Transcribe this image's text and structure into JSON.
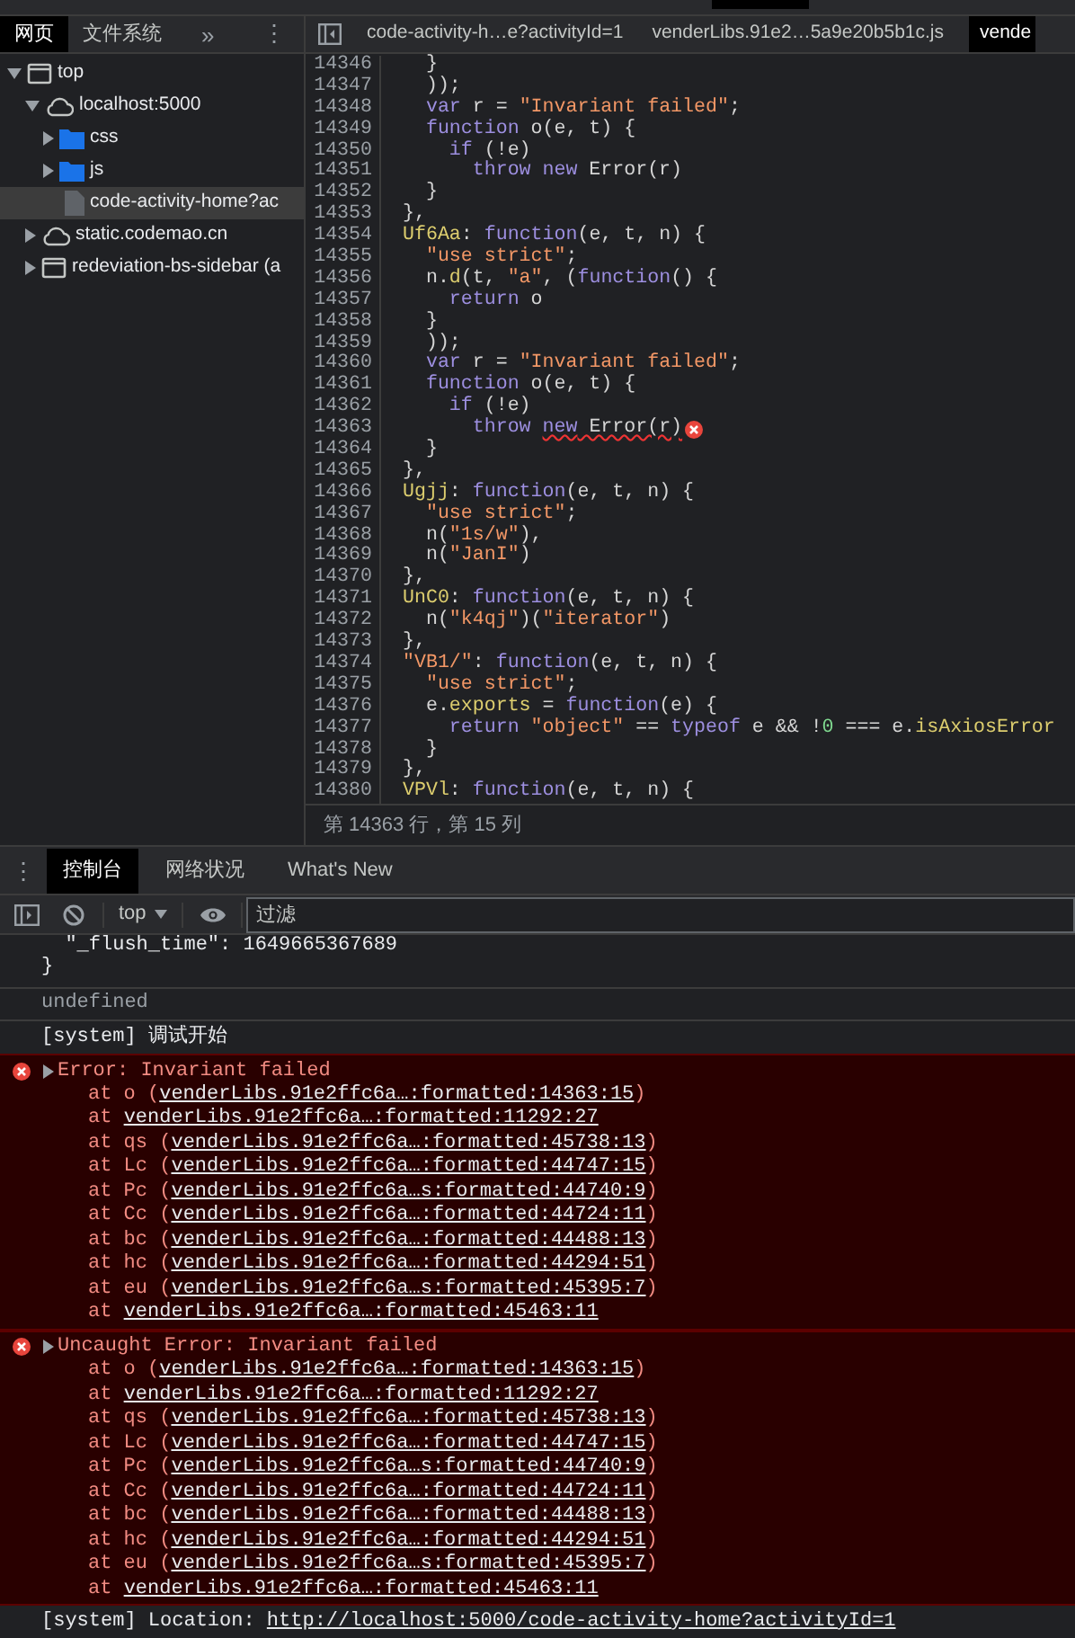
{
  "navigator": {
    "tabs": [
      {
        "label": "网页",
        "selected": true
      },
      {
        "label": "文件系统",
        "selected": false
      }
    ],
    "more": "»",
    "menu": "⋮"
  },
  "tree": [
    {
      "label": "top",
      "kind": "frame",
      "expanded": true,
      "selected": false,
      "children": [
        {
          "label": "localhost:5000",
          "kind": "cloud",
          "expanded": true,
          "selected": false,
          "children": [
            {
              "label": "css",
              "kind": "folder",
              "expanded": false,
              "selected": false
            },
            {
              "label": "js",
              "kind": "folder",
              "expanded": false,
              "selected": false
            },
            {
              "label": "code-activity-home?ac",
              "kind": "file",
              "selected": true
            }
          ]
        },
        {
          "label": "static.codemao.cn",
          "kind": "cloud",
          "expanded": false,
          "selected": false
        },
        {
          "label": "redeviation-bs-sidebar (a",
          "kind": "frame",
          "expanded": false,
          "selected": false
        }
      ]
    }
  ],
  "editor": {
    "tabs": [
      {
        "label": "code-activity-h…e?activityId=1",
        "selected": false
      },
      {
        "label": "venderLibs.91e2…5a9e20b5b1c.js",
        "selected": false
      },
      {
        "label": "vende",
        "selected": true
      }
    ],
    "lines": [
      {
        "number": "14346",
        "error": false,
        "tokens": [
          {
            "kind": "plain",
            "text": "  }"
          }
        ]
      },
      {
        "number": "14347",
        "error": false,
        "tokens": [
          {
            "kind": "plain",
            "text": "  ));"
          }
        ]
      },
      {
        "number": "14348",
        "error": false,
        "tokens": [
          {
            "kind": "keyword",
            "text": "  var"
          },
          {
            "kind": "plain",
            "text": " r = "
          },
          {
            "kind": "string",
            "text": "\"Invariant failed\""
          },
          {
            "kind": "plain",
            "text": ";"
          }
        ]
      },
      {
        "number": "14349",
        "error": false,
        "tokens": [
          {
            "kind": "keyword",
            "text": "  function"
          },
          {
            "kind": "plain",
            "text": " o(e, t) {"
          }
        ]
      },
      {
        "number": "14350",
        "error": false,
        "tokens": [
          {
            "kind": "keyword",
            "text": "    if"
          },
          {
            "kind": "plain",
            "text": " (!e)"
          }
        ]
      },
      {
        "number": "14351",
        "error": false,
        "tokens": [
          {
            "kind": "keyword",
            "text": "      throw new"
          },
          {
            "kind": "plain",
            "text": " Error(r)"
          }
        ]
      },
      {
        "number": "14352",
        "error": false,
        "tokens": [
          {
            "kind": "plain",
            "text": "  }"
          }
        ]
      },
      {
        "number": "14353",
        "error": false,
        "tokens": [
          {
            "kind": "plain",
            "text": "},"
          }
        ]
      },
      {
        "number": "14354",
        "error": false,
        "tokens": [
          {
            "kind": "name",
            "text": "Uf6Aa"
          },
          {
            "kind": "plain",
            "text": ": "
          },
          {
            "kind": "keyword",
            "text": "function"
          },
          {
            "kind": "plain",
            "text": "(e, t, n) {"
          }
        ]
      },
      {
        "number": "14355",
        "error": false,
        "tokens": [
          {
            "kind": "string",
            "text": "  \"use strict\""
          },
          {
            "kind": "plain",
            "text": ";"
          }
        ]
      },
      {
        "number": "14356",
        "error": false,
        "tokens": [
          {
            "kind": "plain",
            "text": "  n."
          },
          {
            "kind": "name",
            "text": "d"
          },
          {
            "kind": "plain",
            "text": "(t, "
          },
          {
            "kind": "string",
            "text": "\"a\""
          },
          {
            "kind": "plain",
            "text": ", ("
          },
          {
            "kind": "keyword",
            "text": "function"
          },
          {
            "kind": "plain",
            "text": "() {"
          }
        ]
      },
      {
        "number": "14357",
        "error": false,
        "tokens": [
          {
            "kind": "keyword",
            "text": "    return"
          },
          {
            "kind": "plain",
            "text": " o"
          }
        ]
      },
      {
        "number": "14358",
        "error": false,
        "tokens": [
          {
            "kind": "plain",
            "text": "  }"
          }
        ]
      },
      {
        "number": "14359",
        "error": false,
        "tokens": [
          {
            "kind": "plain",
            "text": "  ));"
          }
        ]
      },
      {
        "number": "14360",
        "error": false,
        "tokens": [
          {
            "kind": "keyword",
            "text": "  var"
          },
          {
            "kind": "plain",
            "text": " r = "
          },
          {
            "kind": "string",
            "text": "\"Invariant failed\""
          },
          {
            "kind": "plain",
            "text": ";"
          }
        ]
      },
      {
        "number": "14361",
        "error": false,
        "tokens": [
          {
            "kind": "keyword",
            "text": "  function"
          },
          {
            "kind": "plain",
            "text": " o(e, t) {"
          }
        ]
      },
      {
        "number": "14362",
        "error": false,
        "tokens": [
          {
            "kind": "keyword",
            "text": "    if"
          },
          {
            "kind": "plain",
            "text": " (!e)"
          }
        ]
      },
      {
        "number": "14363",
        "error": true,
        "tokens": [
          {
            "kind": "keyword",
            "text": "      throw "
          },
          {
            "kind": "keyword",
            "text": "new",
            "flagged": true
          },
          {
            "kind": "plain",
            "text": " Error(r)",
            "flagged": true
          }
        ]
      },
      {
        "number": "14364",
        "error": false,
        "tokens": [
          {
            "kind": "plain",
            "text": "  }"
          }
        ]
      },
      {
        "number": "14365",
        "error": false,
        "tokens": [
          {
            "kind": "plain",
            "text": "},"
          }
        ]
      },
      {
        "number": "14366",
        "error": false,
        "tokens": [
          {
            "kind": "name",
            "text": "Ugjj"
          },
          {
            "kind": "plain",
            "text": ": "
          },
          {
            "kind": "keyword",
            "text": "function"
          },
          {
            "kind": "plain",
            "text": "(e, t, n) {"
          }
        ]
      },
      {
        "number": "14367",
        "error": false,
        "tokens": [
          {
            "kind": "string",
            "text": "  \"use strict\""
          },
          {
            "kind": "plain",
            "text": ";"
          }
        ]
      },
      {
        "number": "14368",
        "error": false,
        "tokens": [
          {
            "kind": "plain",
            "text": "  n("
          },
          {
            "kind": "string",
            "text": "\"1s/w\""
          },
          {
            "kind": "plain",
            "text": "),"
          }
        ]
      },
      {
        "number": "14369",
        "error": false,
        "tokens": [
          {
            "kind": "plain",
            "text": "  n("
          },
          {
            "kind": "string",
            "text": "\"JanI\""
          },
          {
            "kind": "plain",
            "text": ")"
          }
        ]
      },
      {
        "number": "14370",
        "error": false,
        "tokens": [
          {
            "kind": "plain",
            "text": "},"
          }
        ]
      },
      {
        "number": "14371",
        "error": false,
        "tokens": [
          {
            "kind": "name",
            "text": "UnC0"
          },
          {
            "kind": "plain",
            "text": ": "
          },
          {
            "kind": "keyword",
            "text": "function"
          },
          {
            "kind": "plain",
            "text": "(e, t, n) {"
          }
        ]
      },
      {
        "number": "14372",
        "error": false,
        "tokens": [
          {
            "kind": "plain",
            "text": "  n("
          },
          {
            "kind": "string",
            "text": "\"k4qj\""
          },
          {
            "kind": "plain",
            "text": ")("
          },
          {
            "kind": "string",
            "text": "\"iterator\""
          },
          {
            "kind": "plain",
            "text": ")"
          }
        ]
      },
      {
        "number": "14373",
        "error": false,
        "tokens": [
          {
            "kind": "plain",
            "text": "},"
          }
        ]
      },
      {
        "number": "14374",
        "error": false,
        "tokens": [
          {
            "kind": "string",
            "text": "\"VB1/\""
          },
          {
            "kind": "plain",
            "text": ": "
          },
          {
            "kind": "keyword",
            "text": "function"
          },
          {
            "kind": "plain",
            "text": "(e, t, n) {"
          }
        ]
      },
      {
        "number": "14375",
        "error": false,
        "tokens": [
          {
            "kind": "string",
            "text": "  \"use strict\""
          },
          {
            "kind": "plain",
            "text": ";"
          }
        ]
      },
      {
        "number": "14376",
        "error": false,
        "tokens": [
          {
            "kind": "plain",
            "text": "  e."
          },
          {
            "kind": "name",
            "text": "exports"
          },
          {
            "kind": "plain",
            "text": " = "
          },
          {
            "kind": "keyword",
            "text": "function"
          },
          {
            "kind": "plain",
            "text": "(e) {"
          }
        ]
      },
      {
        "number": "14377",
        "error": false,
        "tokens": [
          {
            "kind": "keyword",
            "text": "    return "
          },
          {
            "kind": "string",
            "text": "\"object\""
          },
          {
            "kind": "plain",
            "text": " == "
          },
          {
            "kind": "keyword",
            "text": "typeof"
          },
          {
            "kind": "plain",
            "text": " e && !"
          },
          {
            "kind": "number",
            "text": "0"
          },
          {
            "kind": "plain",
            "text": " === e."
          },
          {
            "kind": "name",
            "text": "isAxiosError"
          }
        ]
      },
      {
        "number": "14378",
        "error": false,
        "tokens": [
          {
            "kind": "plain",
            "text": "  }"
          }
        ]
      },
      {
        "number": "14379",
        "error": false,
        "tokens": [
          {
            "kind": "plain",
            "text": "},"
          }
        ]
      },
      {
        "number": "14380",
        "error": false,
        "tokens": [
          {
            "kind": "name",
            "text": "VPVl"
          },
          {
            "kind": "plain",
            "text": ": "
          },
          {
            "kind": "keyword",
            "text": "function"
          },
          {
            "kind": "plain",
            "text": "(e, t, n) {"
          }
        ]
      }
    ],
    "status": "第 14363 行，第 15 列"
  },
  "drawer": {
    "menu": "⋮",
    "tabs": [
      {
        "label": "控制台",
        "selected": true
      },
      {
        "label": "网络状况",
        "selected": false
      },
      {
        "label": "What's New",
        "selected": false
      }
    ],
    "context": "top",
    "filter": {
      "placeholder": "过滤"
    },
    "messages": [
      {
        "kind": "object",
        "lines": [
          "  \"_flush_time\": 1649665367689",
          "}"
        ]
      },
      {
        "kind": "result",
        "text": "undefined"
      },
      {
        "kind": "log",
        "text": "[system] 调试开始"
      },
      {
        "kind": "error",
        "expanded": false,
        "text": "Error: Invariant failed",
        "frames": [
          {
            "before": "at o (",
            "link": "venderLibs.91e2ffc6a…:formatted:14363:15",
            "after": ")"
          },
          {
            "before": "at ",
            "link": "venderLibs.91e2ffc6a…:formatted:11292:27"
          },
          {
            "before": "at qs (",
            "link": "venderLibs.91e2ffc6a…:formatted:45738:13",
            "after": ")"
          },
          {
            "before": "at Lc (",
            "link": "venderLibs.91e2ffc6a…:formatted:44747:15",
            "after": ")"
          },
          {
            "before": "at Pc (",
            "link": "venderLibs.91e2ffc6a…s:formatted:44740:9",
            "after": ")"
          },
          {
            "before": "at Cc (",
            "link": "venderLibs.91e2ffc6a…:formatted:44724:11",
            "after": ")"
          },
          {
            "before": "at bc (",
            "link": "venderLibs.91e2ffc6a…:formatted:44488:13",
            "after": ")"
          },
          {
            "before": "at hc (",
            "link": "venderLibs.91e2ffc6a…:formatted:44294:51",
            "after": ")"
          },
          {
            "before": "at eu (",
            "link": "venderLibs.91e2ffc6a…s:formatted:45395:7",
            "after": ")"
          },
          {
            "before": "at ",
            "link": "venderLibs.91e2ffc6a…:formatted:45463:11"
          }
        ]
      },
      {
        "kind": "error",
        "expanded": false,
        "text": "Uncaught Error: Invariant failed",
        "frames": [
          {
            "before": "at o (",
            "link": "venderLibs.91e2ffc6a…:formatted:14363:15",
            "after": ")"
          },
          {
            "before": "at ",
            "link": "venderLibs.91e2ffc6a…:formatted:11292:27"
          },
          {
            "before": "at qs (",
            "link": "venderLibs.91e2ffc6a…:formatted:45738:13",
            "after": ")"
          },
          {
            "before": "at Lc (",
            "link": "venderLibs.91e2ffc6a…:formatted:44747:15",
            "after": ")"
          },
          {
            "before": "at Pc (",
            "link": "venderLibs.91e2ffc6a…s:formatted:44740:9",
            "after": ")"
          },
          {
            "before": "at Cc (",
            "link": "venderLibs.91e2ffc6a…:formatted:44724:11",
            "after": ")"
          },
          {
            "before": "at bc (",
            "link": "venderLibs.91e2ffc6a…:formatted:44488:13",
            "after": ")"
          },
          {
            "before": "at hc (",
            "link": "venderLibs.91e2ffc6a…:formatted:44294:51",
            "after": ")"
          },
          {
            "before": "at eu (",
            "link": "venderLibs.91e2ffc6a…s:formatted:45395:7",
            "after": ")"
          },
          {
            "before": "at ",
            "link": "venderLibs.91e2ffc6a…:formatted:45463:11"
          }
        ]
      },
      {
        "kind": "log",
        "text": "[system] Location: ",
        "link": "http://localhost:5000/code-activity-home?activityId=1"
      }
    ]
  }
}
